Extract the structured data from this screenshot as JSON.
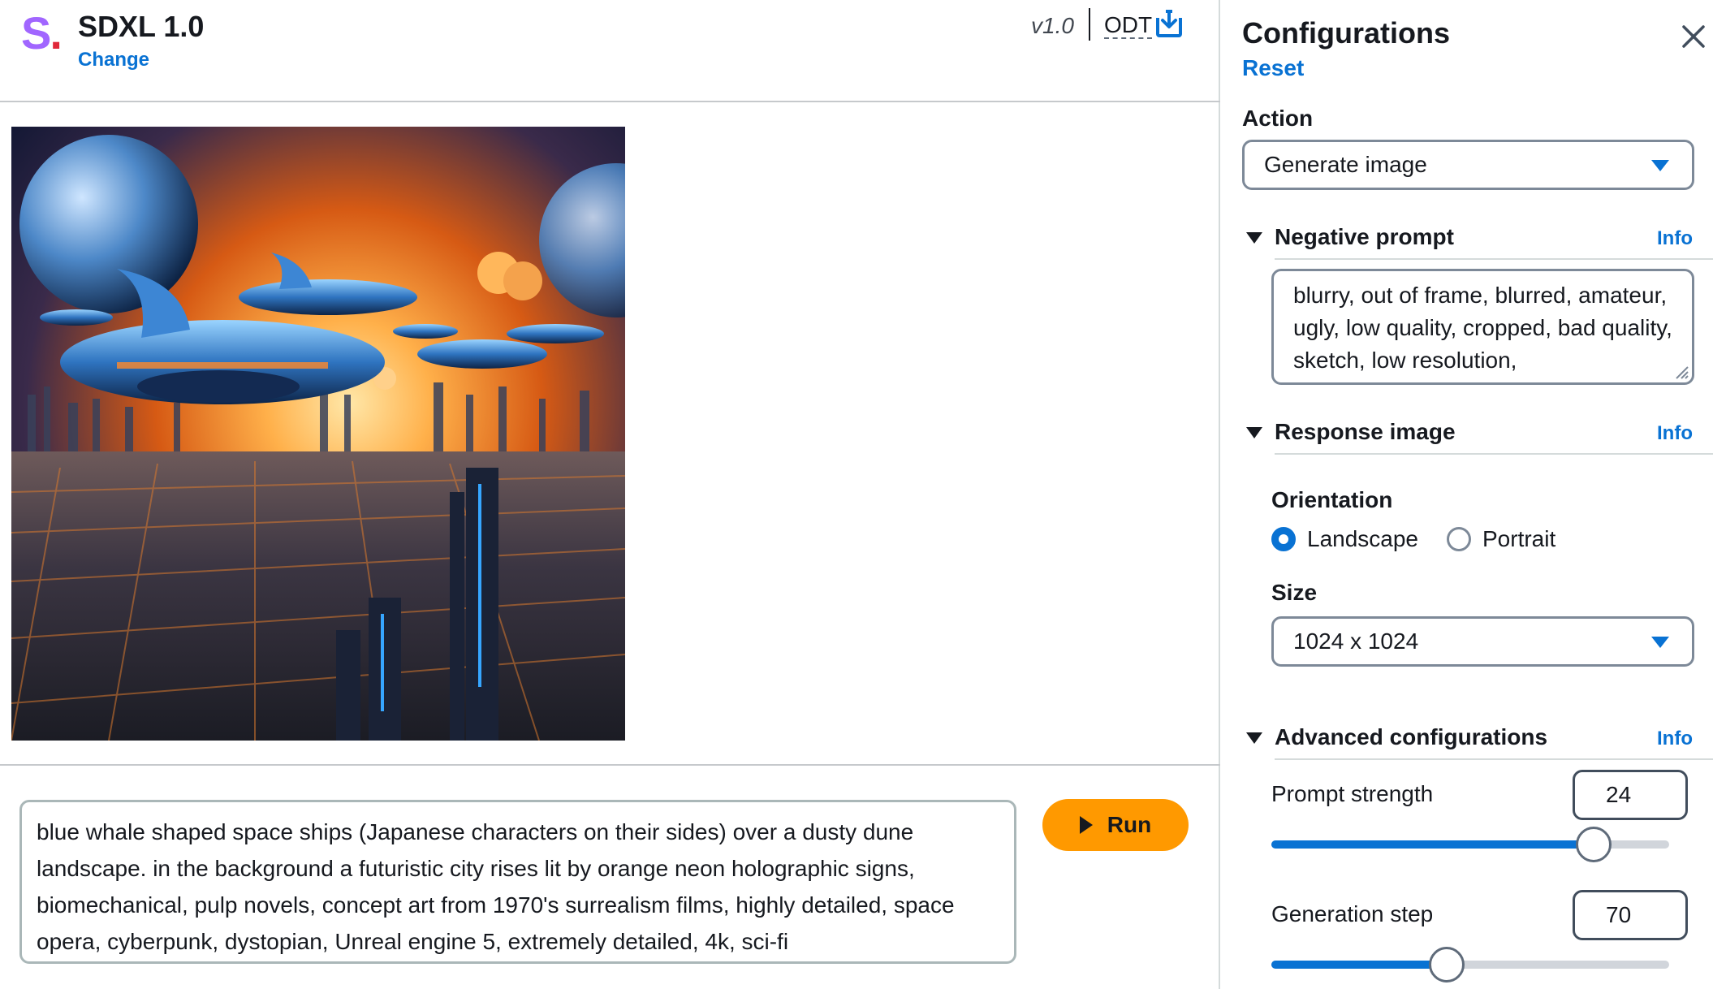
{
  "header": {
    "logo_letter": "S",
    "logo_dot": ".",
    "model_name": "SDXL 1.0",
    "change_link": "Change",
    "version": "v1.0",
    "odt_label": "ODT"
  },
  "prompt": {
    "text": "blue whale shaped space ships (Japanese characters on their sides) over a dusty dune landscape. in the background a futuristic city rises lit by orange neon holographic signs, biomechanical, pulp novels, concept art from 1970's surrealism films, highly detailed, space opera, cyberpunk, dystopian, Unreal engine 5, extremely detailed, 4k, sci-fi"
  },
  "run_button": {
    "label": "Run"
  },
  "panel": {
    "title": "Configurations",
    "reset_link": "Reset",
    "action": {
      "label": "Action",
      "selected": "Generate image"
    },
    "negative_prompt": {
      "title": "Negative prompt",
      "info": "Info",
      "value": "blurry, out of frame, blurred, amateur, ugly, low quality, cropped, bad quality, sketch, low resolution,"
    },
    "response_image": {
      "title": "Response image",
      "info": "Info",
      "orientation_label": "Orientation",
      "options": [
        "Landscape",
        "Portrait"
      ],
      "selected_orientation": "Landscape",
      "size_label": "Size",
      "size_value": "1024 x 1024"
    },
    "advanced": {
      "title": "Advanced configurations",
      "info": "Info",
      "prompt_strength": {
        "label": "Prompt strength",
        "value": "24",
        "level_percent": 81
      },
      "generation_step": {
        "label": "Generation step",
        "value": "70",
        "level_percent": 44
      }
    }
  },
  "colors": {
    "accent": "#0972d3",
    "run_button": "#ff9900",
    "logo_purple": "#a166ff",
    "logo_red": "#e0283a"
  }
}
